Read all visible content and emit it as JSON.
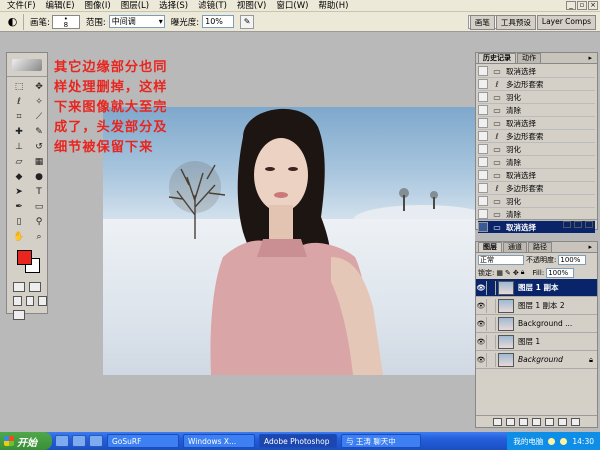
{
  "menubar": {
    "items": [
      "文件(F)",
      "编辑(E)",
      "图像(I)",
      "图层(L)",
      "选择(S)",
      "滤镜(T)",
      "视图(V)",
      "窗口(W)",
      "帮助(H)"
    ]
  },
  "options": {
    "brush_label": "画笔:",
    "brush_size": "8",
    "mode_label": "范围:",
    "mode_value": "中间调",
    "exposure_label": "曝光度:",
    "exposure_value": "10%",
    "tabs": [
      "画笔",
      "工具预设",
      "Layer Comps"
    ]
  },
  "note": {
    "text": "其它边缘部分也同样处理删掉，这样下来图像就大至完成了，头发部分及细节被保留下来"
  },
  "history": {
    "tabs": [
      "历史记录",
      "动作"
    ],
    "rows": [
      {
        "label": "取消选择",
        "icon": "selection"
      },
      {
        "label": "多边形套索",
        "icon": "lasso"
      },
      {
        "label": "羽化",
        "icon": "selection"
      },
      {
        "label": "清除",
        "icon": "selection"
      },
      {
        "label": "取消选择",
        "icon": "selection"
      },
      {
        "label": "多边形套索",
        "icon": "lasso"
      },
      {
        "label": "羽化",
        "icon": "selection"
      },
      {
        "label": "清除",
        "icon": "selection"
      },
      {
        "label": "取消选择",
        "icon": "selection"
      },
      {
        "label": "多边形套索",
        "icon": "lasso"
      },
      {
        "label": "羽化",
        "icon": "selection"
      },
      {
        "label": "清除",
        "icon": "selection"
      },
      {
        "label": "取消选择",
        "icon": "selection"
      }
    ]
  },
  "layers": {
    "tabs": [
      "图层",
      "通道",
      "路径"
    ],
    "blend_mode": "正常",
    "opacity_label": "不透明度:",
    "opacity_value": "100%",
    "lock_label": "锁定:",
    "fill_label": "Fill:",
    "fill_value": "100%",
    "rows": [
      {
        "name": "图层 1 副本"
      },
      {
        "name": "图层 1 副本 2"
      },
      {
        "name": "Background ..."
      },
      {
        "name": "图层 1"
      },
      {
        "name": "Background"
      }
    ]
  },
  "taskbar": {
    "start_label": "开始",
    "tasks": [
      "GoSuRF",
      "Windows X...",
      "Adobe Photoshop",
      "与 王涛 聊天中"
    ],
    "tray_label": "我的电脑",
    "clock": "14:30"
  },
  "colors": {
    "foreground": "#e8251f",
    "background": "#ffffff",
    "note": "#e8251f",
    "selection": "#0a246a"
  }
}
